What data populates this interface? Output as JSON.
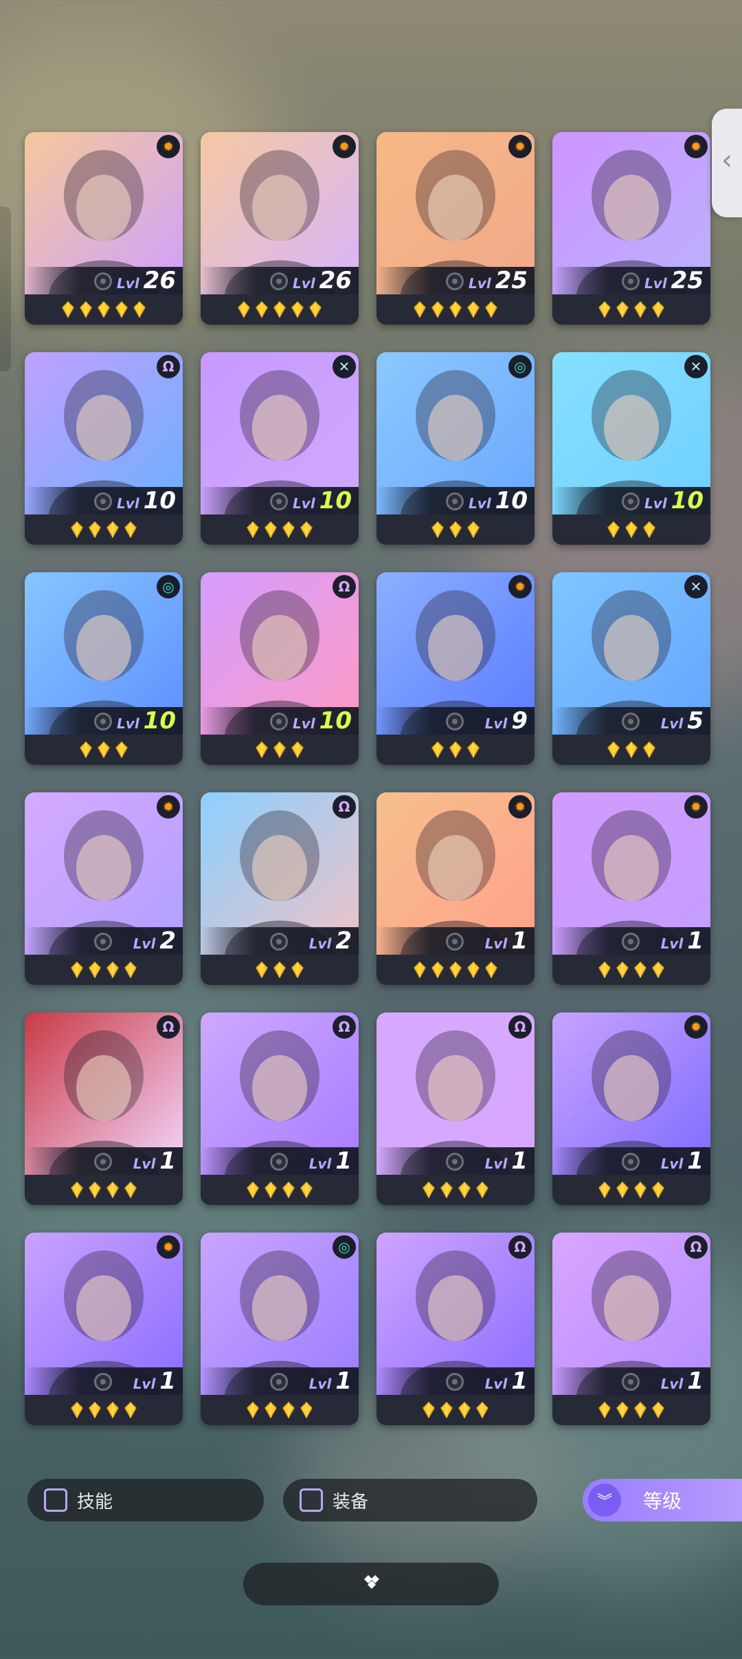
{
  "cards": [
    {
      "level": "26",
      "level_prefix": "Lvl",
      "stars": 5,
      "badge": "orange",
      "badge_icon": "sun-gear-icon",
      "level_color": "white",
      "bg": [
        "#f4c89b",
        "#cfa0ff"
      ]
    },
    {
      "level": "26",
      "level_prefix": "Lvl",
      "stars": 5,
      "badge": "orange",
      "badge_icon": "sun-gear-icon",
      "level_color": "white",
      "bg": [
        "#f5c8a0",
        "#d7b5ff"
      ]
    },
    {
      "level": "25",
      "level_prefix": "Lvl",
      "stars": 5,
      "badge": "orange",
      "badge_icon": "sun-gear-icon",
      "level_color": "white",
      "bg": [
        "#f6b986",
        "#f1a88a"
      ]
    },
    {
      "level": "25",
      "level_prefix": "Lvl",
      "stars": 4,
      "badge": "orange",
      "badge_icon": "sun-gear-icon",
      "level_color": "white",
      "bg": [
        "#cf95ff",
        "#b9b1ff"
      ]
    },
    {
      "level": "10",
      "level_prefix": "Lvl",
      "stars": 4,
      "badge": "purple",
      "badge_icon": "omega-icon",
      "level_color": "white",
      "bg": [
        "#c0a0ff",
        "#6cb0ff"
      ]
    },
    {
      "level": "10",
      "level_prefix": "Lvl",
      "stars": 4,
      "badge": "blue",
      "badge_icon": "cross-icon",
      "level_color": "green",
      "bg": [
        "#c79aff",
        "#d0a8ff"
      ]
    },
    {
      "level": "10",
      "level_prefix": "Lvl",
      "stars": 3,
      "badge": "teal",
      "badge_icon": "swirl-icon",
      "level_color": "white",
      "bg": [
        "#8cc8ff",
        "#6aa8ff"
      ]
    },
    {
      "level": "10",
      "level_prefix": "Lvl",
      "stars": 3,
      "badge": "blue",
      "badge_icon": "cross-icon",
      "level_color": "green",
      "bg": [
        "#86e0ff",
        "#6fcfff"
      ]
    },
    {
      "level": "10",
      "level_prefix": "Lvl",
      "stars": 3,
      "badge": "teal",
      "badge_icon": "swirl-icon",
      "level_color": "green",
      "bg": [
        "#86c6ff",
        "#5f8fff"
      ]
    },
    {
      "level": "10",
      "level_prefix": "Lvl",
      "stars": 3,
      "badge": "purple",
      "badge_icon": "omega-icon",
      "level_color": "green",
      "bg": [
        "#d49dff",
        "#ff9ac4"
      ]
    },
    {
      "level": "9",
      "level_prefix": "Lvl",
      "stars": 3,
      "badge": "orange",
      "badge_icon": "sun-gear-icon",
      "level_color": "white",
      "bg": [
        "#8ab0ff",
        "#5c7bff"
      ]
    },
    {
      "level": "5",
      "level_prefix": "Lvl",
      "stars": 3,
      "badge": "blue",
      "badge_icon": "cross-icon",
      "level_color": "white",
      "bg": [
        "#7ec6ff",
        "#64a5ff"
      ]
    },
    {
      "level": "2",
      "level_prefix": "Lvl",
      "stars": 4,
      "badge": "orange",
      "badge_icon": "sun-gear-icon",
      "level_color": "white",
      "bg": [
        "#d6a9ff",
        "#b0a0ff"
      ]
    },
    {
      "level": "2",
      "level_prefix": "Lvl",
      "stars": 3,
      "badge": "purple",
      "badge_icon": "omega-icon",
      "level_color": "white",
      "bg": [
        "#8cd0ff",
        "#f0c2c6"
      ]
    },
    {
      "level": "1",
      "level_prefix": "Lvl",
      "stars": 5,
      "badge": "orange",
      "badge_icon": "sun-gear-icon",
      "level_color": "white",
      "bg": [
        "#f6c08d",
        "#ffa08a"
      ]
    },
    {
      "level": "1",
      "level_prefix": "Lvl",
      "stars": 4,
      "badge": "orange",
      "badge_icon": "sun-gear-icon",
      "level_color": "white",
      "bg": [
        "#d39aff",
        "#c39eff"
      ]
    },
    {
      "level": "1",
      "level_prefix": "Lvl",
      "stars": 4,
      "badge": "purple",
      "badge_icon": "omega-icon",
      "level_color": "white",
      "bg": [
        "#c93a46",
        "#f4d9ff"
      ]
    },
    {
      "level": "1",
      "level_prefix": "Lvl",
      "stars": 4,
      "badge": "purple",
      "badge_icon": "omega-icon",
      "level_color": "white",
      "bg": [
        "#cfa8ff",
        "#a77cff"
      ]
    },
    {
      "level": "1",
      "level_prefix": "Lvl",
      "stars": 4,
      "badge": "purple",
      "badge_icon": "omega-icon",
      "level_color": "white",
      "bg": [
        "#d6a8ff",
        "#d7a7ff"
      ]
    },
    {
      "level": "1",
      "level_prefix": "Lvl",
      "stars": 4,
      "badge": "orange",
      "badge_icon": "sun-gear-icon",
      "level_color": "white",
      "bg": [
        "#c7a3ff",
        "#7e6bff"
      ]
    },
    {
      "level": "1",
      "level_prefix": "Lvl",
      "stars": 4,
      "badge": "orange",
      "badge_icon": "sun-gear-icon",
      "level_color": "white",
      "bg": [
        "#c9a2ff",
        "#8a6dff"
      ]
    },
    {
      "level": "1",
      "level_prefix": "Lvl",
      "stars": 4,
      "badge": "teal",
      "badge_icon": "swirl-icon",
      "level_color": "white",
      "bg": [
        "#c9a5ff",
        "#9b7dff"
      ]
    },
    {
      "level": "1",
      "level_prefix": "Lvl",
      "stars": 4,
      "badge": "purple",
      "badge_icon": "omega-icon",
      "level_color": "white",
      "bg": [
        "#cfa4ff",
        "#8b6dff"
      ]
    },
    {
      "level": "1",
      "level_prefix": "Lvl",
      "stars": 4,
      "badge": "purple",
      "badge_icon": "omega-icon",
      "level_color": "white",
      "bg": [
        "#d9a5ff",
        "#b58dff"
      ]
    }
  ],
  "filters": {
    "skill_label": "技能",
    "equipment_label": "装备"
  },
  "sort": {
    "label": "等级"
  }
}
